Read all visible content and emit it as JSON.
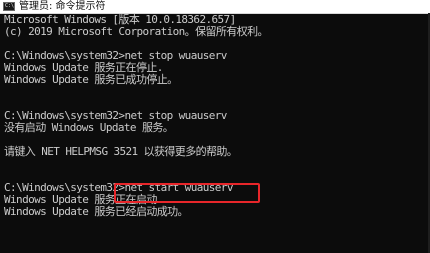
{
  "window": {
    "title": "管理员: 命令提示符",
    "icon": "cmd-icon",
    "icon_glyph": "C:\\"
  },
  "console": {
    "lines": [
      "Microsoft Windows [版本 10.0.18362.657]",
      "(c) 2019 Microsoft Corporation。保留所有权利。",
      "",
      "C:\\Windows\\system32>net stop wuauserv",
      "Windows Update 服务正在停止.",
      "Windows Update 服务已成功停止。",
      "",
      "",
      "C:\\Windows\\system32>net stop wuauserv",
      "没有启动 Windows Update 服务。",
      "",
      "请键入 NET HELPMSG 3521 以获得更多的帮助。",
      "",
      "",
      "C:\\Windows\\system32>net start wuauserv",
      "Windows Update 服务正在启动 .",
      "Windows Update 服务已经启动成功。"
    ]
  },
  "annotation": {
    "color": "#e8262a"
  }
}
